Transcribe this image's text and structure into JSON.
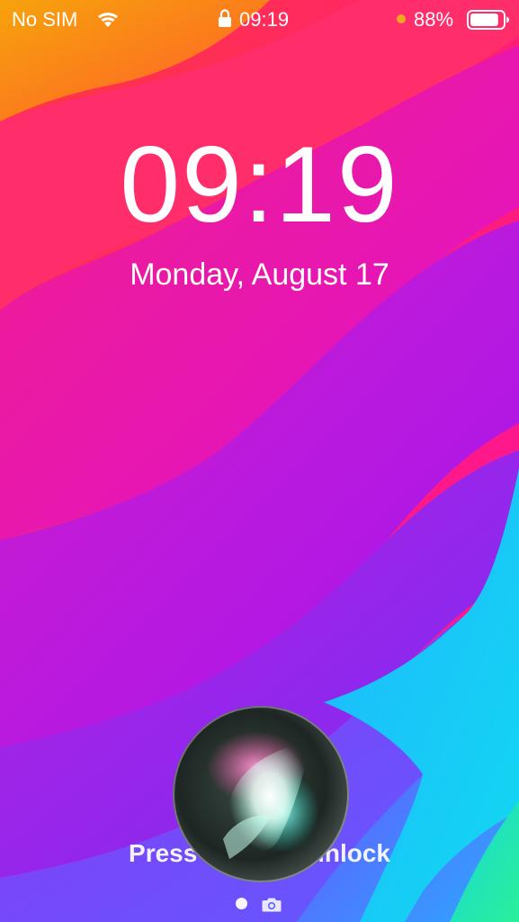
{
  "status_bar": {
    "carrier": "No SIM",
    "time": "09:19",
    "battery_percent": "88%",
    "battery_level": 0.88,
    "recording_dot_color": "#F5A623"
  },
  "lock_screen": {
    "clock": "09:19",
    "date": "Monday, August 17",
    "unlock_hint": "Press home to unlock"
  },
  "wallpaper": {
    "colors": [
      "#F59F0F",
      "#FF2E63",
      "#FF1DB3",
      "#C816E8",
      "#8A2BF0",
      "#5B6CFF",
      "#16C5F5",
      "#24E3A6"
    ]
  },
  "siri": {
    "active": true
  },
  "icons": {
    "wifi": "wifi-icon",
    "lock": "lock-icon",
    "battery": "battery-icon",
    "camera": "camera-icon",
    "page_dot": "page-dot"
  }
}
